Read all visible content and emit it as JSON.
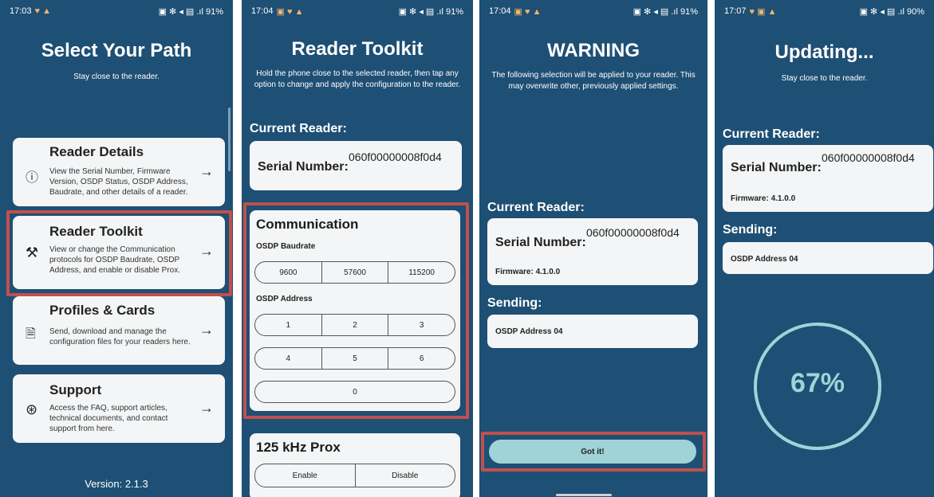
{
  "screen1": {
    "status_time": "17:03",
    "status_right": "▣ ✻ ◂ ▤ .ıl 91%",
    "title": "Select Your Path",
    "subtitle": "Stay close to the reader.",
    "items": [
      {
        "title": "Reader Details",
        "desc": "View the Serial Number, Firmware Version, OSDP Status, OSDP Address, Baudrate, and other details of a reader.",
        "icon": "ⓘ"
      },
      {
        "title": "Reader Toolkit",
        "desc": "View or change the Communication protocols for OSDP Baudrate, OSDP Address, and enable or disable Prox.",
        "icon": "⚒"
      },
      {
        "title": "Profiles & Cards",
        "desc": "Send, download and manage the configuration files for your readers here.",
        "icon": "🗎"
      },
      {
        "title": "Support",
        "desc": "Access the FAQ, support articles, technical documents, and contact support from here.",
        "icon": "⊛"
      }
    ],
    "arrow": "→",
    "version": "Version: 2.1.3"
  },
  "screen2": {
    "status_time": "17:04",
    "status_right": "▣ ✻ ◂ ▤ .ıl 91%",
    "title": "Reader Toolkit",
    "subtitle": "Hold the phone close to the selected reader, then tap any option to change and apply the configuration to the reader.",
    "current_reader_label": "Current Reader:",
    "serial_label": "Serial Number:",
    "serial_value": "060f00000008f0d4",
    "communication_title": "Communication",
    "baudrate_label": "OSDP Baudrate",
    "baudrates": [
      "9600",
      "57600",
      "115200"
    ],
    "address_label": "OSDP Address",
    "addresses_row1": [
      "1",
      "2",
      "3"
    ],
    "addresses_row2": [
      "4",
      "5",
      "6"
    ],
    "addresses_row3": [
      "0"
    ],
    "prox_title": "125 kHz Prox",
    "prox_options": [
      "Enable",
      "Disable"
    ]
  },
  "screen3": {
    "status_time": "17:04",
    "status_right": "▣ ✻ ◂ ▤ .ıl 91%",
    "title": "WARNING",
    "subtitle": "The following selection will be applied to your reader. This may overwrite other, previously applied settings.",
    "current_reader_label": "Current Reader:",
    "serial_label": "Serial Number:",
    "serial_value": "060f00000008f0d4",
    "firmware": "Firmware: 4.1.0.0",
    "sending_label": "Sending:",
    "sending_value": "OSDP Address 04",
    "button": "Got it!"
  },
  "screen4": {
    "status_time": "17:07",
    "status_right": "▣ ✻ ◂ ▤ .ıl 90%",
    "title": "Updating...",
    "subtitle": "Stay close to the reader.",
    "current_reader_label": "Current Reader:",
    "serial_label": "Serial Number:",
    "serial_value": "060f00000008f0d4",
    "firmware": "Firmware: 4.1.0.0",
    "sending_label": "Sending:",
    "sending_value": "OSDP Address 04",
    "progress_text": "67%",
    "progress": 0.67
  },
  "colors": {
    "bg": "#1e4f74",
    "card": "#f4f5f6",
    "highlight": "#c0504d",
    "accent": "#9fd3d8"
  }
}
